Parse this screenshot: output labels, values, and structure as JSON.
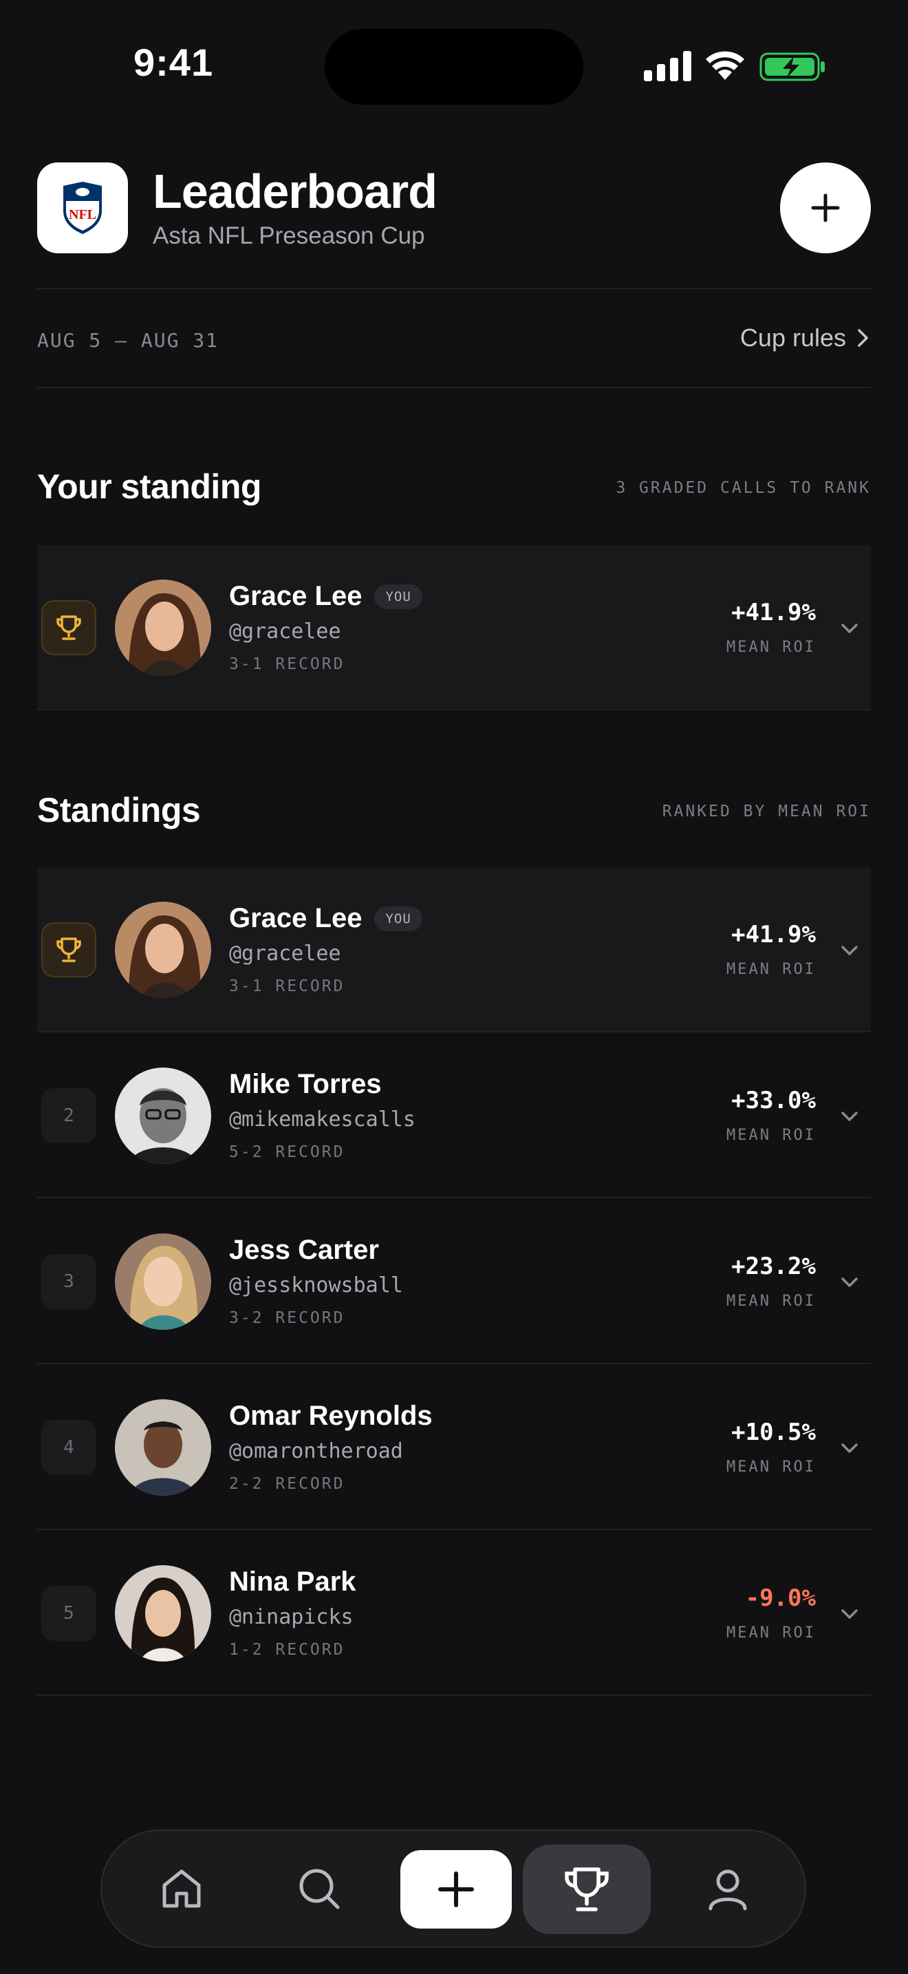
{
  "status_bar": {
    "time": "9:41"
  },
  "header": {
    "title": "Leaderboard",
    "subtitle": "Asta NFL Preseason Cup",
    "logo_text": "NFL",
    "add_icon": "plus-icon"
  },
  "cup": {
    "date_range": "AUG 5 – AUG 31",
    "rules_label": "Cup rules"
  },
  "your_standing": {
    "title": "Your standing",
    "note": "3 GRADED CALLS TO RANK",
    "row": {
      "rank_icon": "trophy-icon",
      "name": "Grace Lee",
      "badge": "YOU",
      "handle": "@gracelee",
      "record": "3-1 RECORD",
      "roi": "+41.9%",
      "roi_label": "MEAN ROI"
    }
  },
  "standings": {
    "title": "Standings",
    "note": "RANKED BY MEAN ROI",
    "rows": [
      {
        "rank": "1",
        "rank_icon": "trophy-icon",
        "name": "Grace Lee",
        "badge": "YOU",
        "handle": "@gracelee",
        "record": "3-1 RECORD",
        "roi": "+41.9%",
        "roi_label": "MEAN ROI"
      },
      {
        "rank": "2",
        "name": "Mike Torres",
        "handle": "@mikemakescalls",
        "record": "5-2 RECORD",
        "roi": "+33.0%",
        "roi_label": "MEAN ROI"
      },
      {
        "rank": "3",
        "name": "Jess Carter",
        "handle": "@jessknowsball",
        "record": "3-2 RECORD",
        "roi": "+23.2%",
        "roi_label": "MEAN ROI"
      },
      {
        "rank": "4",
        "name": "Omar Reynolds",
        "handle": "@omarontheroad",
        "record": "2-2 RECORD",
        "roi": "+10.5%",
        "roi_label": "MEAN ROI"
      },
      {
        "rank": "5",
        "name": "Nina Park",
        "handle": "@ninapicks",
        "record": "1-2 RECORD",
        "roi": "-9.0%",
        "roi_label": "MEAN ROI"
      }
    ]
  },
  "tab_bar": {
    "tabs": [
      "home-icon",
      "search-icon",
      "plus-icon",
      "trophy-icon",
      "profile-icon"
    ],
    "active": "trophy-icon"
  },
  "colors": {
    "background": "#111113",
    "accent_gold": "#f0b43c",
    "negative": "#ff7757",
    "battery_green": "#34c759"
  }
}
